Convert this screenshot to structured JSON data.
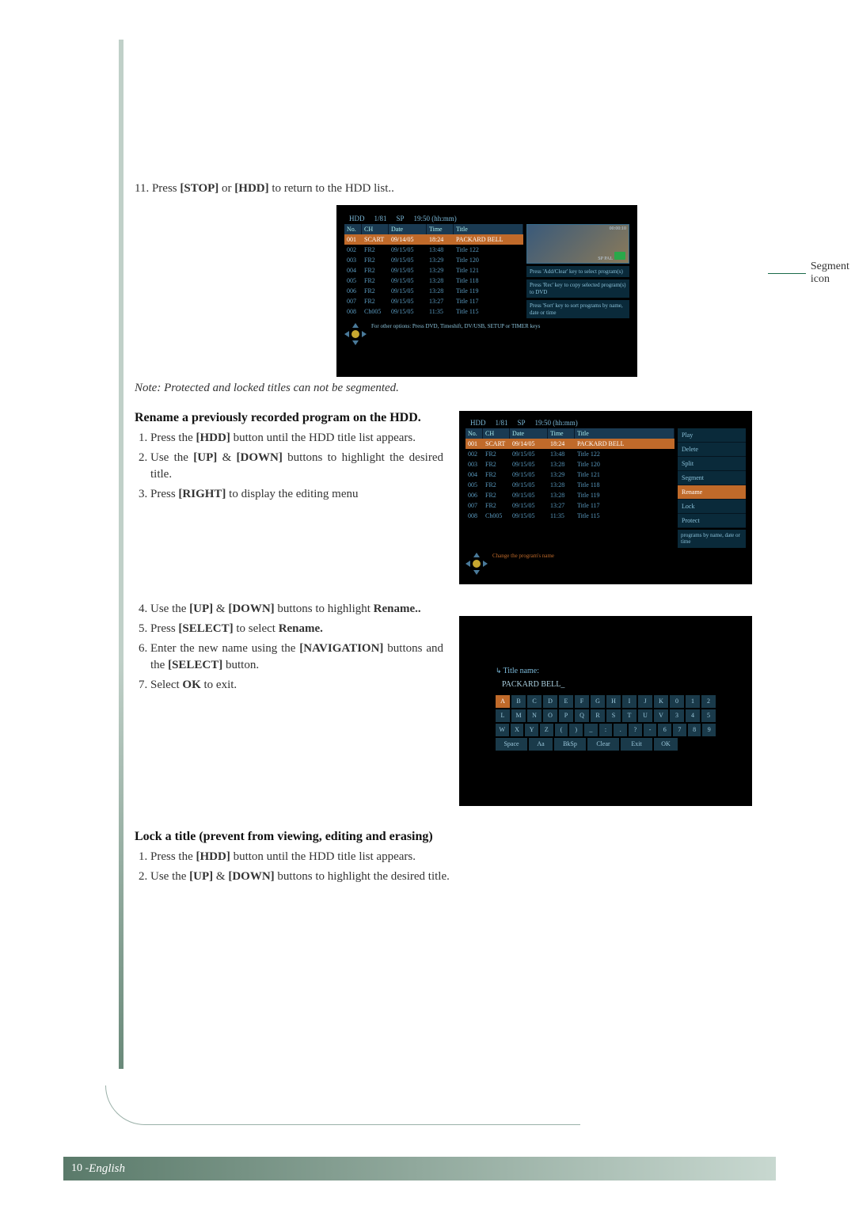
{
  "step11": {
    "num": "11.",
    "prefix": "Press ",
    "b1": "[STOP]",
    "mid": " or ",
    "b2": "[HDD]",
    "suffix": " to return to the HDD list.."
  },
  "callout_segment": "Segment icon",
  "note_line": "Note: Protected and locked titles can not be segmented.",
  "rename": {
    "heading": "Rename a previously recorded program on the HDD.",
    "s1": {
      "num": "1.",
      "pre": "Press the ",
      "b": "[HDD]",
      "post": " button until the HDD title list appears."
    },
    "s2": {
      "num": "2.",
      "pre": "Use the ",
      "b1": "[UP]",
      "mid": " & ",
      "b2": "[DOWN]",
      "post": " buttons to highlight the desired title."
    },
    "s3": {
      "num": "3.",
      "pre": "Press ",
      "b": "[RIGHT]",
      "post": " to display the editing menu"
    },
    "s4": {
      "num": "4.",
      "pre": "Use the ",
      "b1": "[UP]",
      "mid": " & ",
      "b2": "[DOWN]",
      "post": " buttons to highlight ",
      "b3": "Rename.."
    },
    "s5": {
      "num": "5.",
      "pre": "Press ",
      "b1": "[SELECT]",
      "mid": " to select ",
      "b2": "Rename."
    },
    "s6": {
      "num": "6.",
      "pre": "Enter the new name using the ",
      "b1": "[NAVIGATION]",
      "mid": " buttons and the ",
      "b2": "[SELECT]",
      "post": " button."
    },
    "s7": {
      "num": "7.",
      "pre": "Select ",
      "b": "OK",
      "post": " to exit."
    }
  },
  "lock": {
    "heading": "Lock a title (prevent from viewing, editing and erasing)",
    "s1": {
      "num": "1.",
      "pre": "Press the ",
      "b": "[HDD]",
      "post": " button until the HDD title list appears."
    },
    "s2": {
      "num": "2.",
      "pre": "Use the ",
      "b1": "[UP]",
      "mid": " & ",
      "b2": "[DOWN]",
      "post": " buttons to highlight the desired title."
    }
  },
  "footer": {
    "page": "10 - ",
    "lang": "English"
  },
  "osdA": {
    "hdr": {
      "icon": "HDD",
      "idx": "1/81",
      "q": "SP",
      "time": "19:50 (hh:mm)"
    },
    "cols": {
      "no": "No.",
      "ch": "CH",
      "date": "Date",
      "time": "Time",
      "title": "Title"
    },
    "rows": [
      {
        "no": "001",
        "ch": "SCART",
        "date": "09/14/05",
        "time": "18:24",
        "title": "PACKARD BELL"
      },
      {
        "no": "002",
        "ch": "FR2",
        "date": "09/15/05",
        "time": "13:48",
        "title": "Title 122"
      },
      {
        "no": "003",
        "ch": "FR2",
        "date": "09/15/05",
        "time": "13:29",
        "title": "Title 120"
      },
      {
        "no": "004",
        "ch": "FR2",
        "date": "09/15/05",
        "time": "13:29",
        "title": "Title 121"
      },
      {
        "no": "005",
        "ch": "FR2",
        "date": "09/15/05",
        "time": "13:28",
        "title": "Title 118"
      },
      {
        "no": "006",
        "ch": "FR2",
        "date": "09/15/05",
        "time": "13:28",
        "title": "Title 119"
      },
      {
        "no": "007",
        "ch": "FR2",
        "date": "09/15/05",
        "time": "13:27",
        "title": "Title 117"
      },
      {
        "no": "008",
        "ch": "Ch005",
        "date": "09/15/05",
        "time": "11:35",
        "title": "Title 115"
      }
    ],
    "thumb_info": "SP PAL",
    "thumb_time": "00:00:10",
    "hints": [
      "Press 'Add/Clear' key to select program(s)",
      "Press 'Rec' key to copy selected program(s) to DVD",
      "Press 'Sort' key to sort programs by name, date or time"
    ],
    "foot_line": "For other options: Press DVD, Timeshift, DV/USB, SETUP or TIMER keys"
  },
  "osdB": {
    "hdr": {
      "icon": "HDD",
      "idx": "1/81",
      "q": "SP",
      "time": "19:50 (hh:mm)"
    },
    "rows": [
      {
        "no": "001",
        "ch": "SCART",
        "date": "09/14/05",
        "time": "18:24",
        "title": "PACKARD BELL"
      },
      {
        "no": "002",
        "ch": "FR2",
        "date": "09/15/05",
        "time": "13:48",
        "title": "Title 122"
      },
      {
        "no": "003",
        "ch": "FR2",
        "date": "09/15/05",
        "time": "13:28",
        "title": "Title 120"
      },
      {
        "no": "004",
        "ch": "FR2",
        "date": "09/15/05",
        "time": "13:29",
        "title": "Title 121"
      },
      {
        "no": "005",
        "ch": "FR2",
        "date": "09/15/05",
        "time": "13:28",
        "title": "Title 118"
      },
      {
        "no": "006",
        "ch": "FR2",
        "date": "09/15/05",
        "time": "13:28",
        "title": "Title 119"
      },
      {
        "no": "007",
        "ch": "FR2",
        "date": "09/15/05",
        "time": "13:27",
        "title": "Title 117"
      },
      {
        "no": "008",
        "ch": "Ch005",
        "date": "09/15/05",
        "time": "11:35",
        "title": "Title 115"
      }
    ],
    "menu": [
      "Play",
      "Delete",
      "Split",
      "Segment",
      "Rename",
      "Lock",
      "Protect"
    ],
    "foot_line": "Change the program's name",
    "hint_tail": "programs by name, date or time"
  },
  "osdC": {
    "title_label": "Title name:",
    "field": "PACKARD BELL_",
    "rows": [
      [
        "A",
        "B",
        "C",
        "D",
        "E",
        "F",
        "G",
        "H",
        "I",
        "J",
        "K",
        "0",
        "1",
        "2"
      ],
      [
        "L",
        "M",
        "N",
        "O",
        "P",
        "Q",
        "R",
        "S",
        "T",
        "U",
        "V",
        "3",
        "4",
        "5"
      ],
      [
        "W",
        "X",
        "Y",
        "Z",
        "(",
        ")",
        "_",
        ":",
        ".",
        "?",
        "-",
        "6",
        "7",
        "8",
        "9"
      ]
    ],
    "actions": [
      "Space",
      "Aa",
      "BkSp",
      "Clear",
      "Exit",
      "OK"
    ]
  }
}
